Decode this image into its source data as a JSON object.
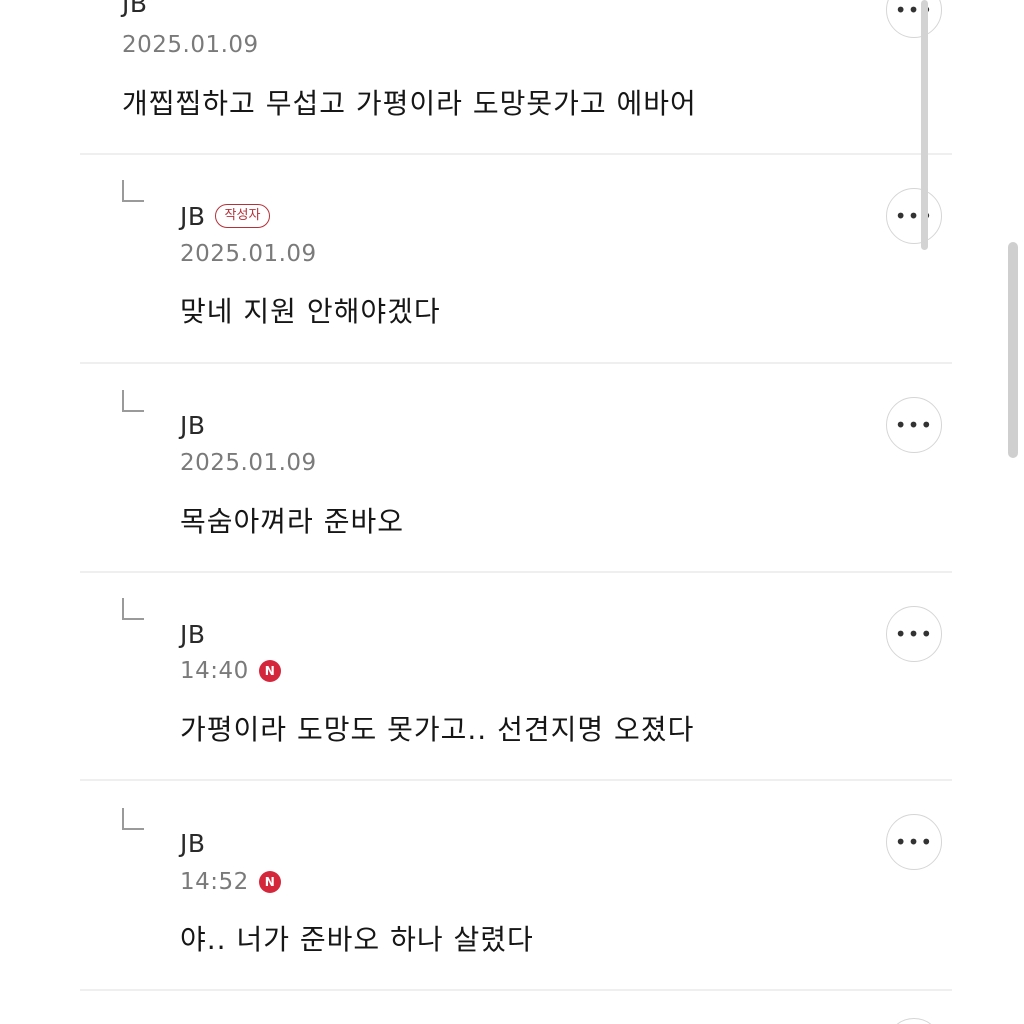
{
  "comments": [
    {
      "author": "JB",
      "writer_badge": "",
      "date": "2025.01.09",
      "new": false,
      "text": "개찝찝하고 무섭고 가평이라 도망못가고 에바어",
      "more_icon": "more-horizontal-icon"
    },
    {
      "author": "JB",
      "writer_badge": "작성자",
      "date": "2025.01.09",
      "new": false,
      "text": "맞네 지원 안해야겠다",
      "more_icon": "more-horizontal-icon"
    },
    {
      "author": "JB",
      "writer_badge": "",
      "date": "2025.01.09",
      "new": false,
      "text": "목숨아껴라 준바오",
      "more_icon": "more-horizontal-icon"
    },
    {
      "author": "JB",
      "writer_badge": "",
      "date": "14:40",
      "new": true,
      "new_label": "N",
      "text": "가평이라 도망도 못가고.. 선견지명 오졌다",
      "more_icon": "more-horizontal-icon"
    },
    {
      "author": "JB",
      "writer_badge": "",
      "date": "14:52",
      "new": true,
      "new_label": "N",
      "text": "야.. 너가 준바오 하나 살렸다",
      "more_icon": "more-horizontal-icon"
    }
  ],
  "more_button_glyph": "•••",
  "colors": {
    "writer_badge": "#b5313a",
    "new_badge": "#d4273b",
    "divider": "#efefef",
    "date_text": "#7a7a7a"
  }
}
